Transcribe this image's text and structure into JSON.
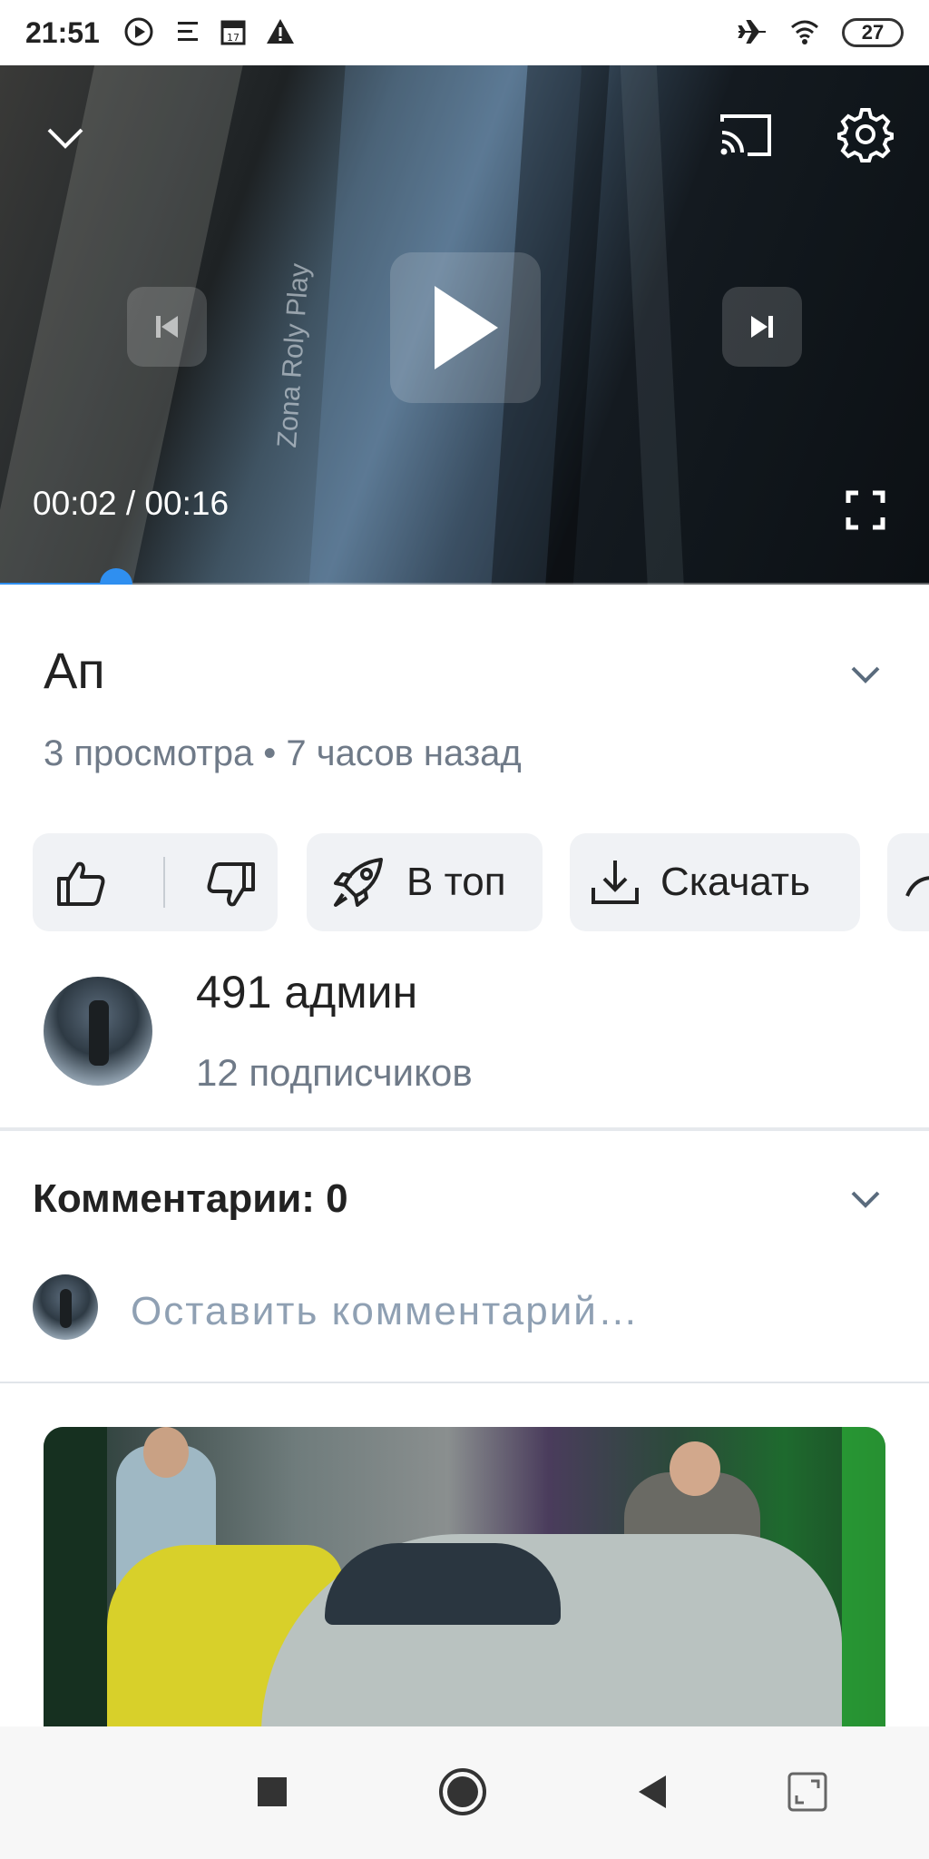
{
  "status_bar": {
    "time": "21:51",
    "battery": "27",
    "icons": [
      "play-circle-icon",
      "menu-icon",
      "calendar-icon",
      "warning-icon",
      "airplane-icon",
      "wifi-icon",
      "battery-icon"
    ]
  },
  "player": {
    "time_display": "00:02 / 00:16",
    "progress": 0.125,
    "accent_color": "#2f8ff0",
    "overlay_text": "Zona Roly Play",
    "icons": [
      "chevron-down-icon",
      "cast-icon",
      "settings-icon",
      "skip-previous-icon",
      "play-icon",
      "skip-next-icon",
      "fullscreen-icon"
    ]
  },
  "video": {
    "title": "Ап",
    "meta": "3 просмотра • 7 часов назад"
  },
  "actions": {
    "top_label": "В топ",
    "download_label": "Скачать"
  },
  "channel": {
    "name": "491 админ",
    "subscribers": "12 подписчиков"
  },
  "comments": {
    "title": "Комментарии: 0",
    "placeholder": "Оставить комментарий…"
  },
  "nav_bar": {
    "icons": [
      "recents-square-icon",
      "home-circle-icon",
      "back-triangle-icon",
      "screen-rotate-icon"
    ]
  }
}
